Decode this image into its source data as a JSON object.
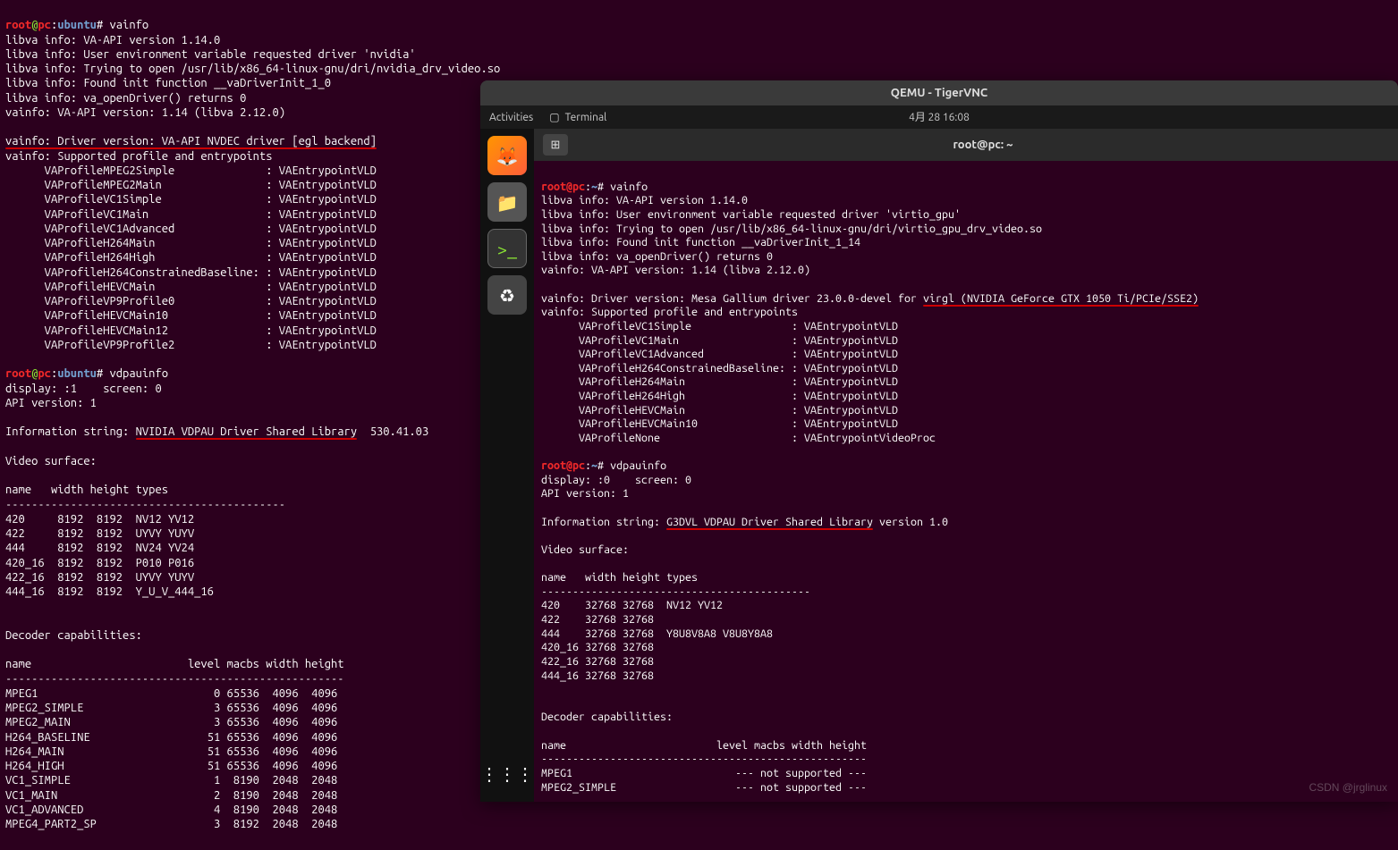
{
  "host_terminal": {
    "prompt1": {
      "user": "root",
      "at": "@",
      "host": "pc",
      "sep": ":",
      "path": "ubuntu",
      "end": "# ",
      "cmd": "vainfo"
    },
    "libva_lines": [
      "libva info: VA-API version 1.14.0",
      "libva info: User environment variable requested driver 'nvidia'",
      "libva info: Trying to open /usr/lib/x86_64-linux-gnu/dri/nvidia_drv_video.so",
      "libva info: Found init function __vaDriverInit_1_0",
      "libva info: va_openDriver() returns 0",
      "vainfo: VA-API version: 1.14 (libva 2.12.0)"
    ],
    "driver_line": "vainfo: Driver version: VA-API NVDEC driver [egl backend]",
    "supported_line": "vainfo: Supported profile and entrypoints",
    "profiles": [
      [
        "VAProfileMPEG2Simple",
        "VAEntrypointVLD"
      ],
      [
        "VAProfileMPEG2Main",
        "VAEntrypointVLD"
      ],
      [
        "VAProfileVC1Simple",
        "VAEntrypointVLD"
      ],
      [
        "VAProfileVC1Main",
        "VAEntrypointVLD"
      ],
      [
        "VAProfileVC1Advanced",
        "VAEntrypointVLD"
      ],
      [
        "VAProfileH264Main",
        "VAEntrypointVLD"
      ],
      [
        "VAProfileH264High",
        "VAEntrypointVLD"
      ],
      [
        "VAProfileH264ConstrainedBaseline:",
        "VAEntrypointVLD"
      ],
      [
        "VAProfileHEVCMain",
        "VAEntrypointVLD"
      ],
      [
        "VAProfileVP9Profile0",
        "VAEntrypointVLD"
      ],
      [
        "VAProfileHEVCMain10",
        "VAEntrypointVLD"
      ],
      [
        "VAProfileHEVCMain12",
        "VAEntrypointVLD"
      ],
      [
        "VAProfileVP9Profile2",
        "VAEntrypointVLD"
      ]
    ],
    "prompt2": {
      "user": "root",
      "at": "@",
      "host": "pc",
      "sep": ":",
      "path": "ubuntu",
      "end": "# ",
      "cmd": "vdpauinfo"
    },
    "vdpau_head": [
      "display: :1    screen: 0",
      "API version: 1"
    ],
    "info_string_pre": "Information string: ",
    "info_string_hl": "NVIDIA VDPAU Driver Shared Library",
    "info_string_post": "  530.41.03",
    "video_surface_title": "Video surface:",
    "video_surface_header": "name   width height types",
    "video_surface_sep": "-------------------------------------------",
    "video_surface_rows": [
      "420     8192  8192  NV12 YV12",
      "422     8192  8192  UYVY YUYV",
      "444     8192  8192  NV24 YV24",
      "420_16  8192  8192  P010 P016",
      "422_16  8192  8192  UYVY YUYV",
      "444_16  8192  8192  Y_U_V_444_16"
    ],
    "decoder_title": "Decoder capabilities:",
    "decoder_header": "name                        level macbs width height",
    "decoder_sep": "----------------------------------------------------",
    "decoder_rows": [
      "MPEG1                           0 65536  4096  4096",
      "MPEG2_SIMPLE                    3 65536  4096  4096",
      "MPEG2_MAIN                      3 65536  4096  4096",
      "H264_BASELINE                  51 65536  4096  4096",
      "H264_MAIN                      51 65536  4096  4096",
      "H264_HIGH                      51 65536  4096  4096",
      "VC1_SIMPLE                      1  8190  2048  2048",
      "VC1_MAIN                        2  8190  2048  2048",
      "VC1_ADVANCED                    4  8190  2048  2048",
      "MPEG4_PART2_SP                  3  8192  2048  2048"
    ]
  },
  "vnc": {
    "title": "QEMU - TigerVNC",
    "topbar": {
      "activities": "Activities",
      "app": "Terminal",
      "clock": "4月 28  16:08"
    },
    "term_header_title": "root@pc: ~",
    "new_tab_glyph": "⊞",
    "prompt1": {
      "user": "root@pc",
      "path": "~",
      "end": "# ",
      "cmd": "vainfo"
    },
    "libva_lines": [
      "libva info: VA-API version 1.14.0",
      "libva info: User environment variable requested driver 'virtio_gpu'",
      "libva info: Trying to open /usr/lib/x86_64-linux-gnu/dri/virtio_gpu_drv_video.so",
      "libva info: Found init function __vaDriverInit_1_14",
      "libva info: va_openDriver() returns 0",
      "vainfo: VA-API version: 1.14 (libva 2.12.0)"
    ],
    "driver_pre": "vainfo: Driver version: Mesa Gallium driver 23.0.0-devel for ",
    "driver_hl": "virgl (NVIDIA GeForce GTX 1050 Ti/PCIe/SSE2)",
    "supported_line": "vainfo: Supported profile and entrypoints",
    "profiles": [
      [
        "VAProfileVC1Simple",
        "VAEntrypointVLD"
      ],
      [
        "VAProfileVC1Main",
        "VAEntrypointVLD"
      ],
      [
        "VAProfileVC1Advanced",
        "VAEntrypointVLD"
      ],
      [
        "VAProfileH264ConstrainedBaseline:",
        "VAEntrypointVLD"
      ],
      [
        "VAProfileH264Main",
        "VAEntrypointVLD"
      ],
      [
        "VAProfileH264High",
        "VAEntrypointVLD"
      ],
      [
        "VAProfileHEVCMain",
        "VAEntrypointVLD"
      ],
      [
        "VAProfileHEVCMain10",
        "VAEntrypointVLD"
      ],
      [
        "VAProfileNone",
        "VAEntrypointVideoProc"
      ]
    ],
    "prompt2": {
      "user": "root@pc",
      "path": "~",
      "end": "# ",
      "cmd": "vdpauinfo"
    },
    "vdpau_head": [
      "display: :0    screen: 0",
      "API version: 1"
    ],
    "info_string_pre": "Information string: ",
    "info_string_hl": "G3DVL VDPAU Driver Shared Library",
    "info_string_post": " version 1.0",
    "video_surface_title": "Video surface:",
    "video_surface_header": "name   width height types",
    "video_surface_sep": "-------------------------------------------",
    "video_surface_rows": [
      "420    32768 32768  NV12 YV12",
      "422    32768 32768",
      "444    32768 32768  Y8U8V8A8 V8U8Y8A8",
      "420_16 32768 32768",
      "422_16 32768 32768",
      "444_16 32768 32768"
    ],
    "decoder_title": "Decoder capabilities:",
    "decoder_header": "name                        level macbs width height",
    "decoder_sep": "----------------------------------------------------",
    "decoder_rows": [
      "MPEG1                          --- not supported ---",
      "MPEG2_SIMPLE                   --- not supported ---"
    ]
  },
  "watermark": "CSDN @jrglinux",
  "icons": {
    "terminal": "❑",
    "firefox": "🦊",
    "files": "📁",
    "trash": "♻",
    "apps": "⋮⋮⋮"
  }
}
